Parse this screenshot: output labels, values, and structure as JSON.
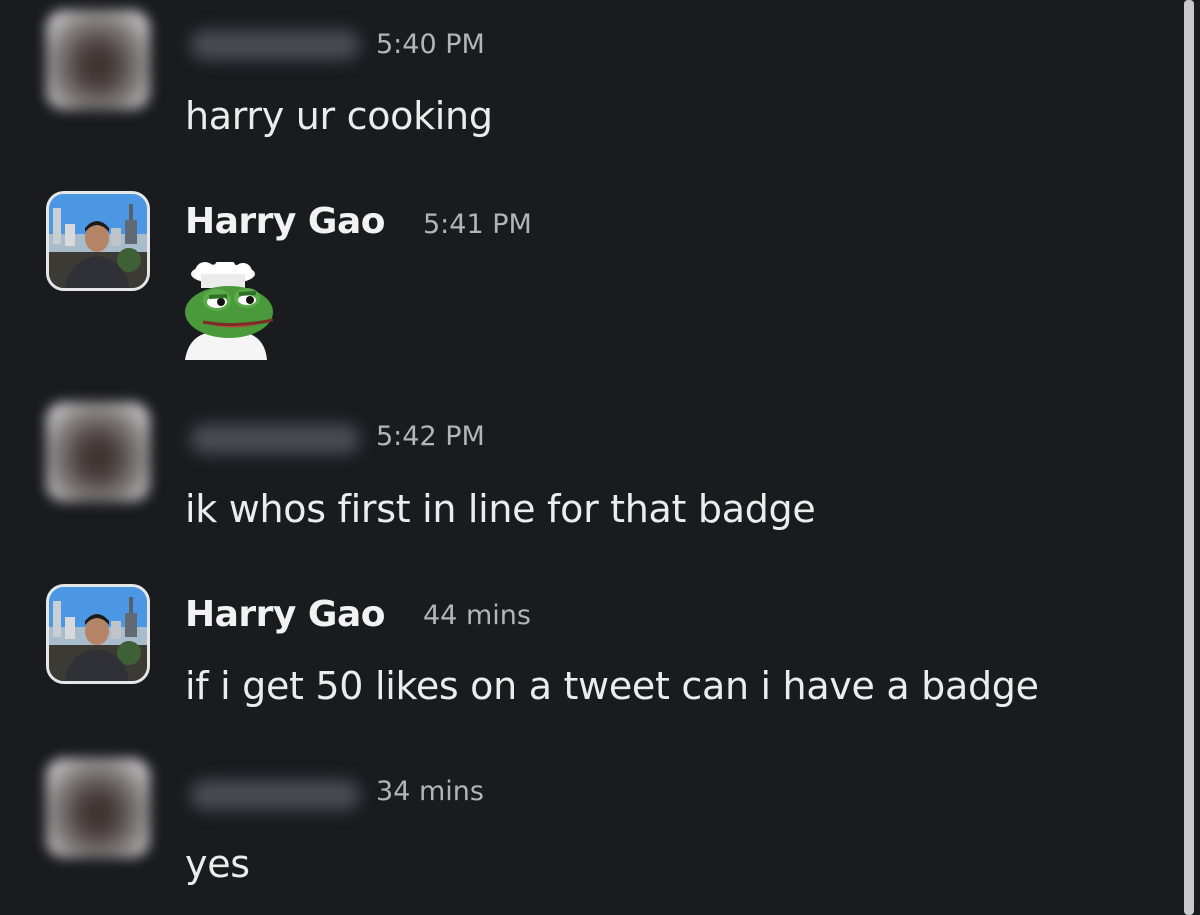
{
  "messages": [
    {
      "sender": "",
      "time": "5:40 PM",
      "text": "harry ur cooking"
    },
    {
      "sender": "Harry Gao",
      "time": "5:41 PM",
      "text": "",
      "attachment": "chef-pepe-emoji"
    },
    {
      "sender": "",
      "time": "5:42 PM",
      "text": "ik whos first in line for that badge"
    },
    {
      "sender": "Harry Gao",
      "time": "44 mins",
      "text": "if i get 50 likes on a tweet can i have a badge"
    },
    {
      "sender": "",
      "time": "34 mins",
      "text": "yes"
    }
  ]
}
